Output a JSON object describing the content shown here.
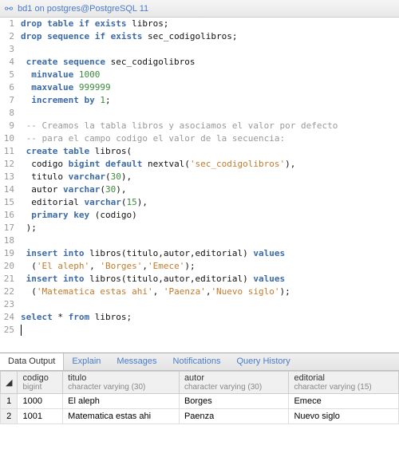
{
  "titlebar": {
    "text": "bd1 on postgres@PostgreSQL 11"
  },
  "lines": [
    {
      "n": 1,
      "t": [
        [
          "kw",
          "drop table if exists"
        ],
        [
          "id",
          " libros;"
        ]
      ]
    },
    {
      "n": 2,
      "t": [
        [
          "kw",
          "drop sequence if exists"
        ],
        [
          "id",
          " sec_codigolibros;"
        ]
      ]
    },
    {
      "n": 3,
      "t": []
    },
    {
      "n": 4,
      "t": [
        [
          "id",
          " "
        ],
        [
          "kw",
          "create sequence"
        ],
        [
          "id",
          " sec_codigolibros"
        ]
      ]
    },
    {
      "n": 5,
      "t": [
        [
          "id",
          "  "
        ],
        [
          "kw",
          "minvalue"
        ],
        [
          "id",
          " "
        ],
        [
          "num",
          "1000"
        ]
      ]
    },
    {
      "n": 6,
      "t": [
        [
          "id",
          "  "
        ],
        [
          "kw",
          "maxvalue"
        ],
        [
          "id",
          " "
        ],
        [
          "num",
          "999999"
        ]
      ]
    },
    {
      "n": 7,
      "t": [
        [
          "id",
          "  "
        ],
        [
          "kw",
          "increment by"
        ],
        [
          "id",
          " "
        ],
        [
          "num",
          "1"
        ],
        [
          "id",
          ";"
        ]
      ]
    },
    {
      "n": 8,
      "t": []
    },
    {
      "n": 9,
      "t": [
        [
          "id",
          " "
        ],
        [
          "cm",
          "-- Creamos la tabla libros y asociamos el valor por defecto"
        ]
      ]
    },
    {
      "n": 10,
      "t": [
        [
          "id",
          " "
        ],
        [
          "cm",
          "-- para el campo codigo el valor de la secuencia:"
        ]
      ]
    },
    {
      "n": 11,
      "t": [
        [
          "id",
          " "
        ],
        [
          "kw",
          "create table"
        ],
        [
          "id",
          " libros("
        ]
      ]
    },
    {
      "n": 12,
      "t": [
        [
          "id",
          "  codigo "
        ],
        [
          "kw",
          "bigint default"
        ],
        [
          "id",
          " nextval("
        ],
        [
          "str",
          "'sec_codigolibros'"
        ],
        [
          "id",
          "),"
        ]
      ]
    },
    {
      "n": 13,
      "t": [
        [
          "id",
          "  titulo "
        ],
        [
          "kw",
          "varchar"
        ],
        [
          "id",
          "("
        ],
        [
          "num",
          "30"
        ],
        [
          "id",
          "),"
        ]
      ]
    },
    {
      "n": 14,
      "t": [
        [
          "id",
          "  autor "
        ],
        [
          "kw",
          "varchar"
        ],
        [
          "id",
          "("
        ],
        [
          "num",
          "30"
        ],
        [
          "id",
          "),"
        ]
      ]
    },
    {
      "n": 15,
      "t": [
        [
          "id",
          "  editorial "
        ],
        [
          "kw",
          "varchar"
        ],
        [
          "id",
          "("
        ],
        [
          "num",
          "15"
        ],
        [
          "id",
          "),"
        ]
      ]
    },
    {
      "n": 16,
      "t": [
        [
          "id",
          "  "
        ],
        [
          "kw",
          "primary key"
        ],
        [
          "id",
          " (codigo)"
        ]
      ]
    },
    {
      "n": 17,
      "t": [
        [
          "id",
          " );"
        ]
      ]
    },
    {
      "n": 18,
      "t": []
    },
    {
      "n": 19,
      "t": [
        [
          "id",
          " "
        ],
        [
          "kw",
          "insert into"
        ],
        [
          "id",
          " libros(titulo,autor,editorial) "
        ],
        [
          "kw",
          "values"
        ]
      ]
    },
    {
      "n": 20,
      "t": [
        [
          "id",
          "  ("
        ],
        [
          "str",
          "'El aleph'"
        ],
        [
          "id",
          ", "
        ],
        [
          "str",
          "'Borges'"
        ],
        [
          "id",
          ","
        ],
        [
          "str",
          "'Emece'"
        ],
        [
          "id",
          ");"
        ]
      ]
    },
    {
      "n": 21,
      "t": [
        [
          "id",
          " "
        ],
        [
          "kw",
          "insert into"
        ],
        [
          "id",
          " libros(titulo,autor,editorial) "
        ],
        [
          "kw",
          "values"
        ]
      ]
    },
    {
      "n": 22,
      "t": [
        [
          "id",
          "  ("
        ],
        [
          "str",
          "'Matematica estas ahi'"
        ],
        [
          "id",
          ", "
        ],
        [
          "str",
          "'Paenza'"
        ],
        [
          "id",
          ","
        ],
        [
          "str",
          "'Nuevo siglo'"
        ],
        [
          "id",
          ");"
        ]
      ]
    },
    {
      "n": 23,
      "t": []
    },
    {
      "n": 24,
      "t": [
        [
          "kw",
          "select"
        ],
        [
          "id",
          " * "
        ],
        [
          "kw",
          "from"
        ],
        [
          "id",
          " libros;"
        ]
      ]
    },
    {
      "n": 25,
      "t": [],
      "cursor": true
    }
  ],
  "tabs": {
    "items": [
      "Data Output",
      "Explain",
      "Messages",
      "Notifications",
      "Query History"
    ],
    "active": 0
  },
  "grid": {
    "cols": [
      {
        "name": "codigo",
        "type": "bigint"
      },
      {
        "name": "titulo",
        "type": "character varying (30)"
      },
      {
        "name": "autor",
        "type": "character varying (30)"
      },
      {
        "name": "editorial",
        "type": "character varying (15)"
      }
    ],
    "rows": [
      [
        "1000",
        "El aleph",
        "Borges",
        "Emece"
      ],
      [
        "1001",
        "Matematica estas ahi",
        "Paenza",
        "Nuevo siglo"
      ]
    ]
  }
}
